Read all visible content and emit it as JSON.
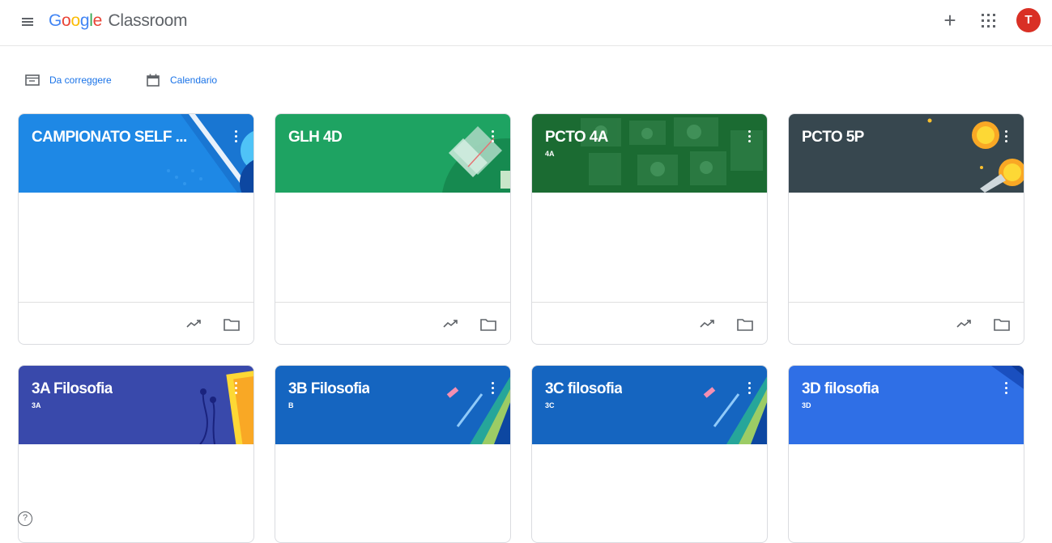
{
  "app": {
    "logo_parts": [
      "G",
      "o",
      "o",
      "g",
      "l",
      "e"
    ],
    "product": "Classroom",
    "avatar_letter": "T"
  },
  "toolbar": {
    "plus_label": "+",
    "links": [
      {
        "label": "Da correggere",
        "icon": "to-review-icon"
      },
      {
        "label": "Calendario",
        "icon": "calendar-icon"
      }
    ]
  },
  "colors": {
    "accent": "#1a73e8",
    "avatar": "#d93025"
  },
  "cards": [
    {
      "title": "CAMPIONATO SELF ...",
      "subtitle": "",
      "banner_color": "#1e88e5"
    },
    {
      "title": "GLH 4D",
      "subtitle": "",
      "banner_color": "#1ea362"
    },
    {
      "title": "PCTO 4A",
      "subtitle": "4A",
      "banner_color": "#1b6b32"
    },
    {
      "title": "PCTO 5P",
      "subtitle": "",
      "banner_color": "#37474f"
    },
    {
      "title": "3A Filosofia",
      "subtitle": "3A",
      "banner_color": "#3949ab"
    },
    {
      "title": "3B Filosofia",
      "subtitle": "B",
      "banner_color": "#1565c0"
    },
    {
      "title": "3C filosofia",
      "subtitle": "3C",
      "banner_color": "#1565c0"
    },
    {
      "title": "3D filosofia",
      "subtitle": "3D",
      "banner_color": "#2f6fe6"
    }
  ],
  "help": {
    "label": "?"
  }
}
